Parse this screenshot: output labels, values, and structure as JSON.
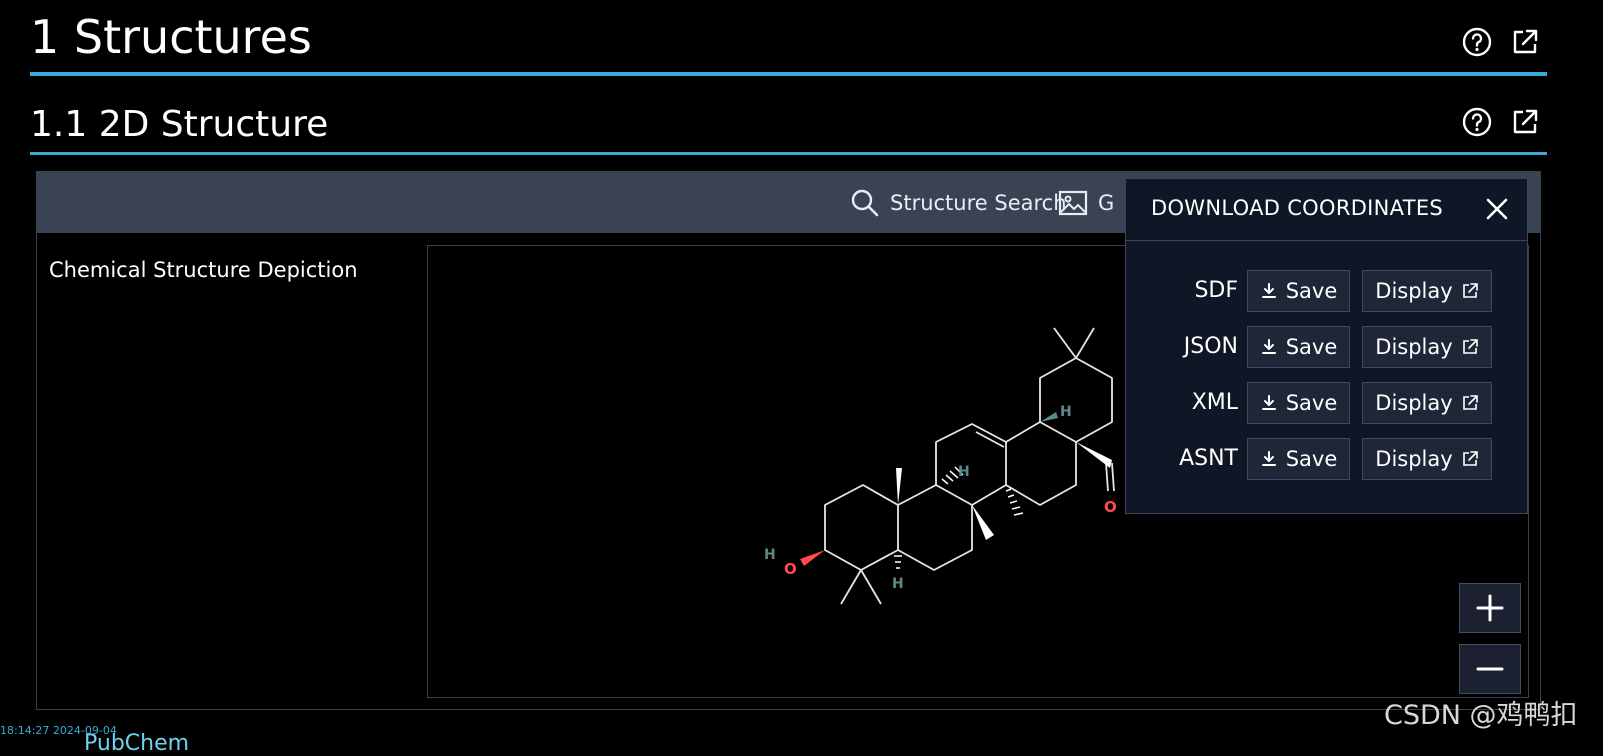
{
  "section": {
    "title": "1 Structures"
  },
  "subsection": {
    "title": "1.1 2D Structure"
  },
  "toolbar": {
    "structure_search_label": "Structure Search",
    "image_button_label": "G"
  },
  "depiction": {
    "label": "Chemical Structure Depiction",
    "atom_labels": [
      "H",
      "O",
      "H",
      "H",
      "H",
      "O"
    ]
  },
  "download": {
    "title": "DOWNLOAD COORDINATES",
    "save_label": "Save",
    "display_label": "Display",
    "formats": [
      "SDF",
      "JSON",
      "XML",
      "ASNT"
    ]
  },
  "colors": {
    "accent": "#39a9d8",
    "toolbar_bg": "#3a4354",
    "popup_bg": "#0f1626",
    "oxygen": "#ff4b4b",
    "hydrogen": "#5a8a8a"
  },
  "footer": {
    "watermark": "CSDN @鸡鸭扣",
    "timestamp": "18:14:27 2024-09-04",
    "brand": "PubChem"
  },
  "icons": {
    "help": "help-circle-icon",
    "open_new": "external-link-icon",
    "search": "search-icon",
    "image": "image-icon",
    "close": "close-icon",
    "download": "download-icon",
    "zoom_in": "plus-icon",
    "zoom_out": "minus-icon"
  }
}
